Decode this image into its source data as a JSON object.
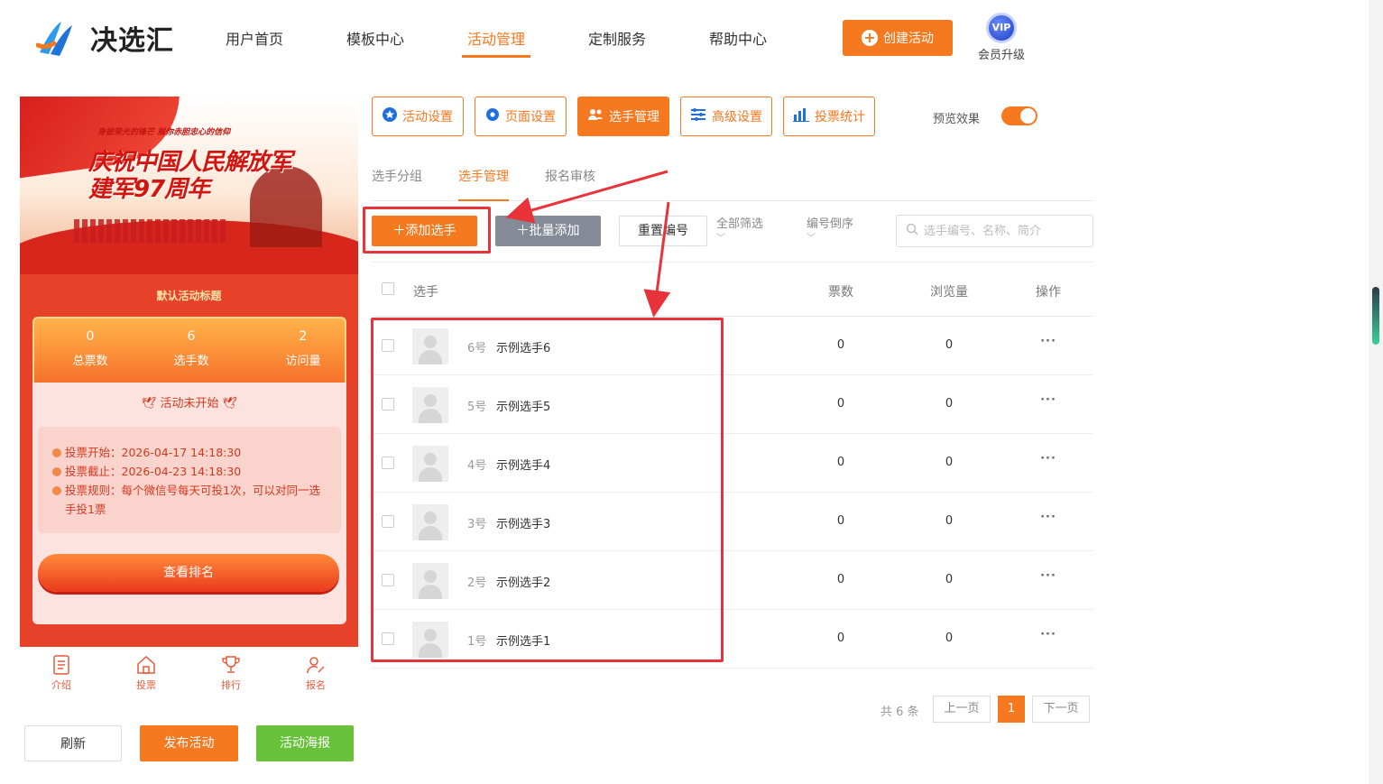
{
  "brand": {
    "name": "决选汇",
    "accent": "#f6781f"
  },
  "nav": {
    "items": [
      {
        "label": "用户首页",
        "active": false
      },
      {
        "label": "模板中心",
        "active": false
      },
      {
        "label": "活动管理",
        "active": true
      },
      {
        "label": "定制服务",
        "active": false
      },
      {
        "label": "帮助中心",
        "active": false
      }
    ],
    "create_label": "创建活动",
    "vip_badge": "VIP",
    "vip_label": "会员升级"
  },
  "preview": {
    "banner_slogan": "身披荣光的锋芒 展你赤胆忠心的信仰",
    "banner_title_1": "庆祝中国人民解放军",
    "banner_title_2": "建军97周年",
    "activity_title": "默认活动标题",
    "stats": [
      {
        "value": "0",
        "label": "总票数"
      },
      {
        "value": "6",
        "label": "选手数"
      },
      {
        "value": "2",
        "label": "访问量"
      }
    ],
    "status": "活动未开始",
    "vote_start": "投票开始：2026-04-17 14:18:30",
    "vote_end": "投票截止：2026-04-23 14:18:30",
    "vote_rule": "投票规则：每个微信号每天可投1次，可以对同一选手投1票",
    "rank_button": "查看排名",
    "tabbar": [
      {
        "label": "介绍",
        "icon": "list-icon"
      },
      {
        "label": "投票",
        "icon": "home-icon"
      },
      {
        "label": "排行",
        "icon": "trophy-icon"
      },
      {
        "label": "报名",
        "icon": "user-edit-icon"
      }
    ]
  },
  "actions": {
    "refresh": "刷新",
    "publish": "发布活动",
    "poster": "活动海报",
    "poster_color": "#67c23a"
  },
  "settings_tabs": [
    {
      "label": "活动设置",
      "icon": "star-icon",
      "active": false
    },
    {
      "label": "页面设置",
      "icon": "gear-icon",
      "active": false
    },
    {
      "label": "选手管理",
      "icon": "users-icon",
      "active": true
    },
    {
      "label": "高级设置",
      "icon": "sliders-icon",
      "active": false
    },
    {
      "label": "投票统计",
      "icon": "bar-chart-icon",
      "active": false
    }
  ],
  "preview_toggle": {
    "label": "预览效果",
    "on": true
  },
  "subtabs": [
    {
      "label": "选手分组",
      "active": false
    },
    {
      "label": "选手管理",
      "active": true
    },
    {
      "label": "报名审核",
      "active": false
    }
  ],
  "toolbar": {
    "add_label": "添加选手",
    "batch_label": "批量添加",
    "reset_label": "重置编号",
    "filter_label": "全部筛选",
    "sort_label": "编号倒序",
    "search_placeholder": "选手编号、名称、简介"
  },
  "table": {
    "headers": {
      "player": "选手",
      "votes": "票数",
      "views": "浏览量",
      "ops": "操作"
    },
    "rows": [
      {
        "num": "6号",
        "name": "示例选手6",
        "votes": "0",
        "views": "0",
        "ops": "···"
      },
      {
        "num": "5号",
        "name": "示例选手5",
        "votes": "0",
        "views": "0",
        "ops": "···"
      },
      {
        "num": "4号",
        "name": "示例选手4",
        "votes": "0",
        "views": "0",
        "ops": "···"
      },
      {
        "num": "3号",
        "name": "示例选手3",
        "votes": "0",
        "views": "0",
        "ops": "···"
      },
      {
        "num": "2号",
        "name": "示例选手2",
        "votes": "0",
        "views": "0",
        "ops": "···"
      },
      {
        "num": "1号",
        "name": "示例选手1",
        "votes": "0",
        "views": "0",
        "ops": "···"
      }
    ]
  },
  "pagination": {
    "total": "共 6 条",
    "prev": "上一页",
    "page": "1",
    "next": "下一页"
  },
  "annotation_color": "#e8333b"
}
